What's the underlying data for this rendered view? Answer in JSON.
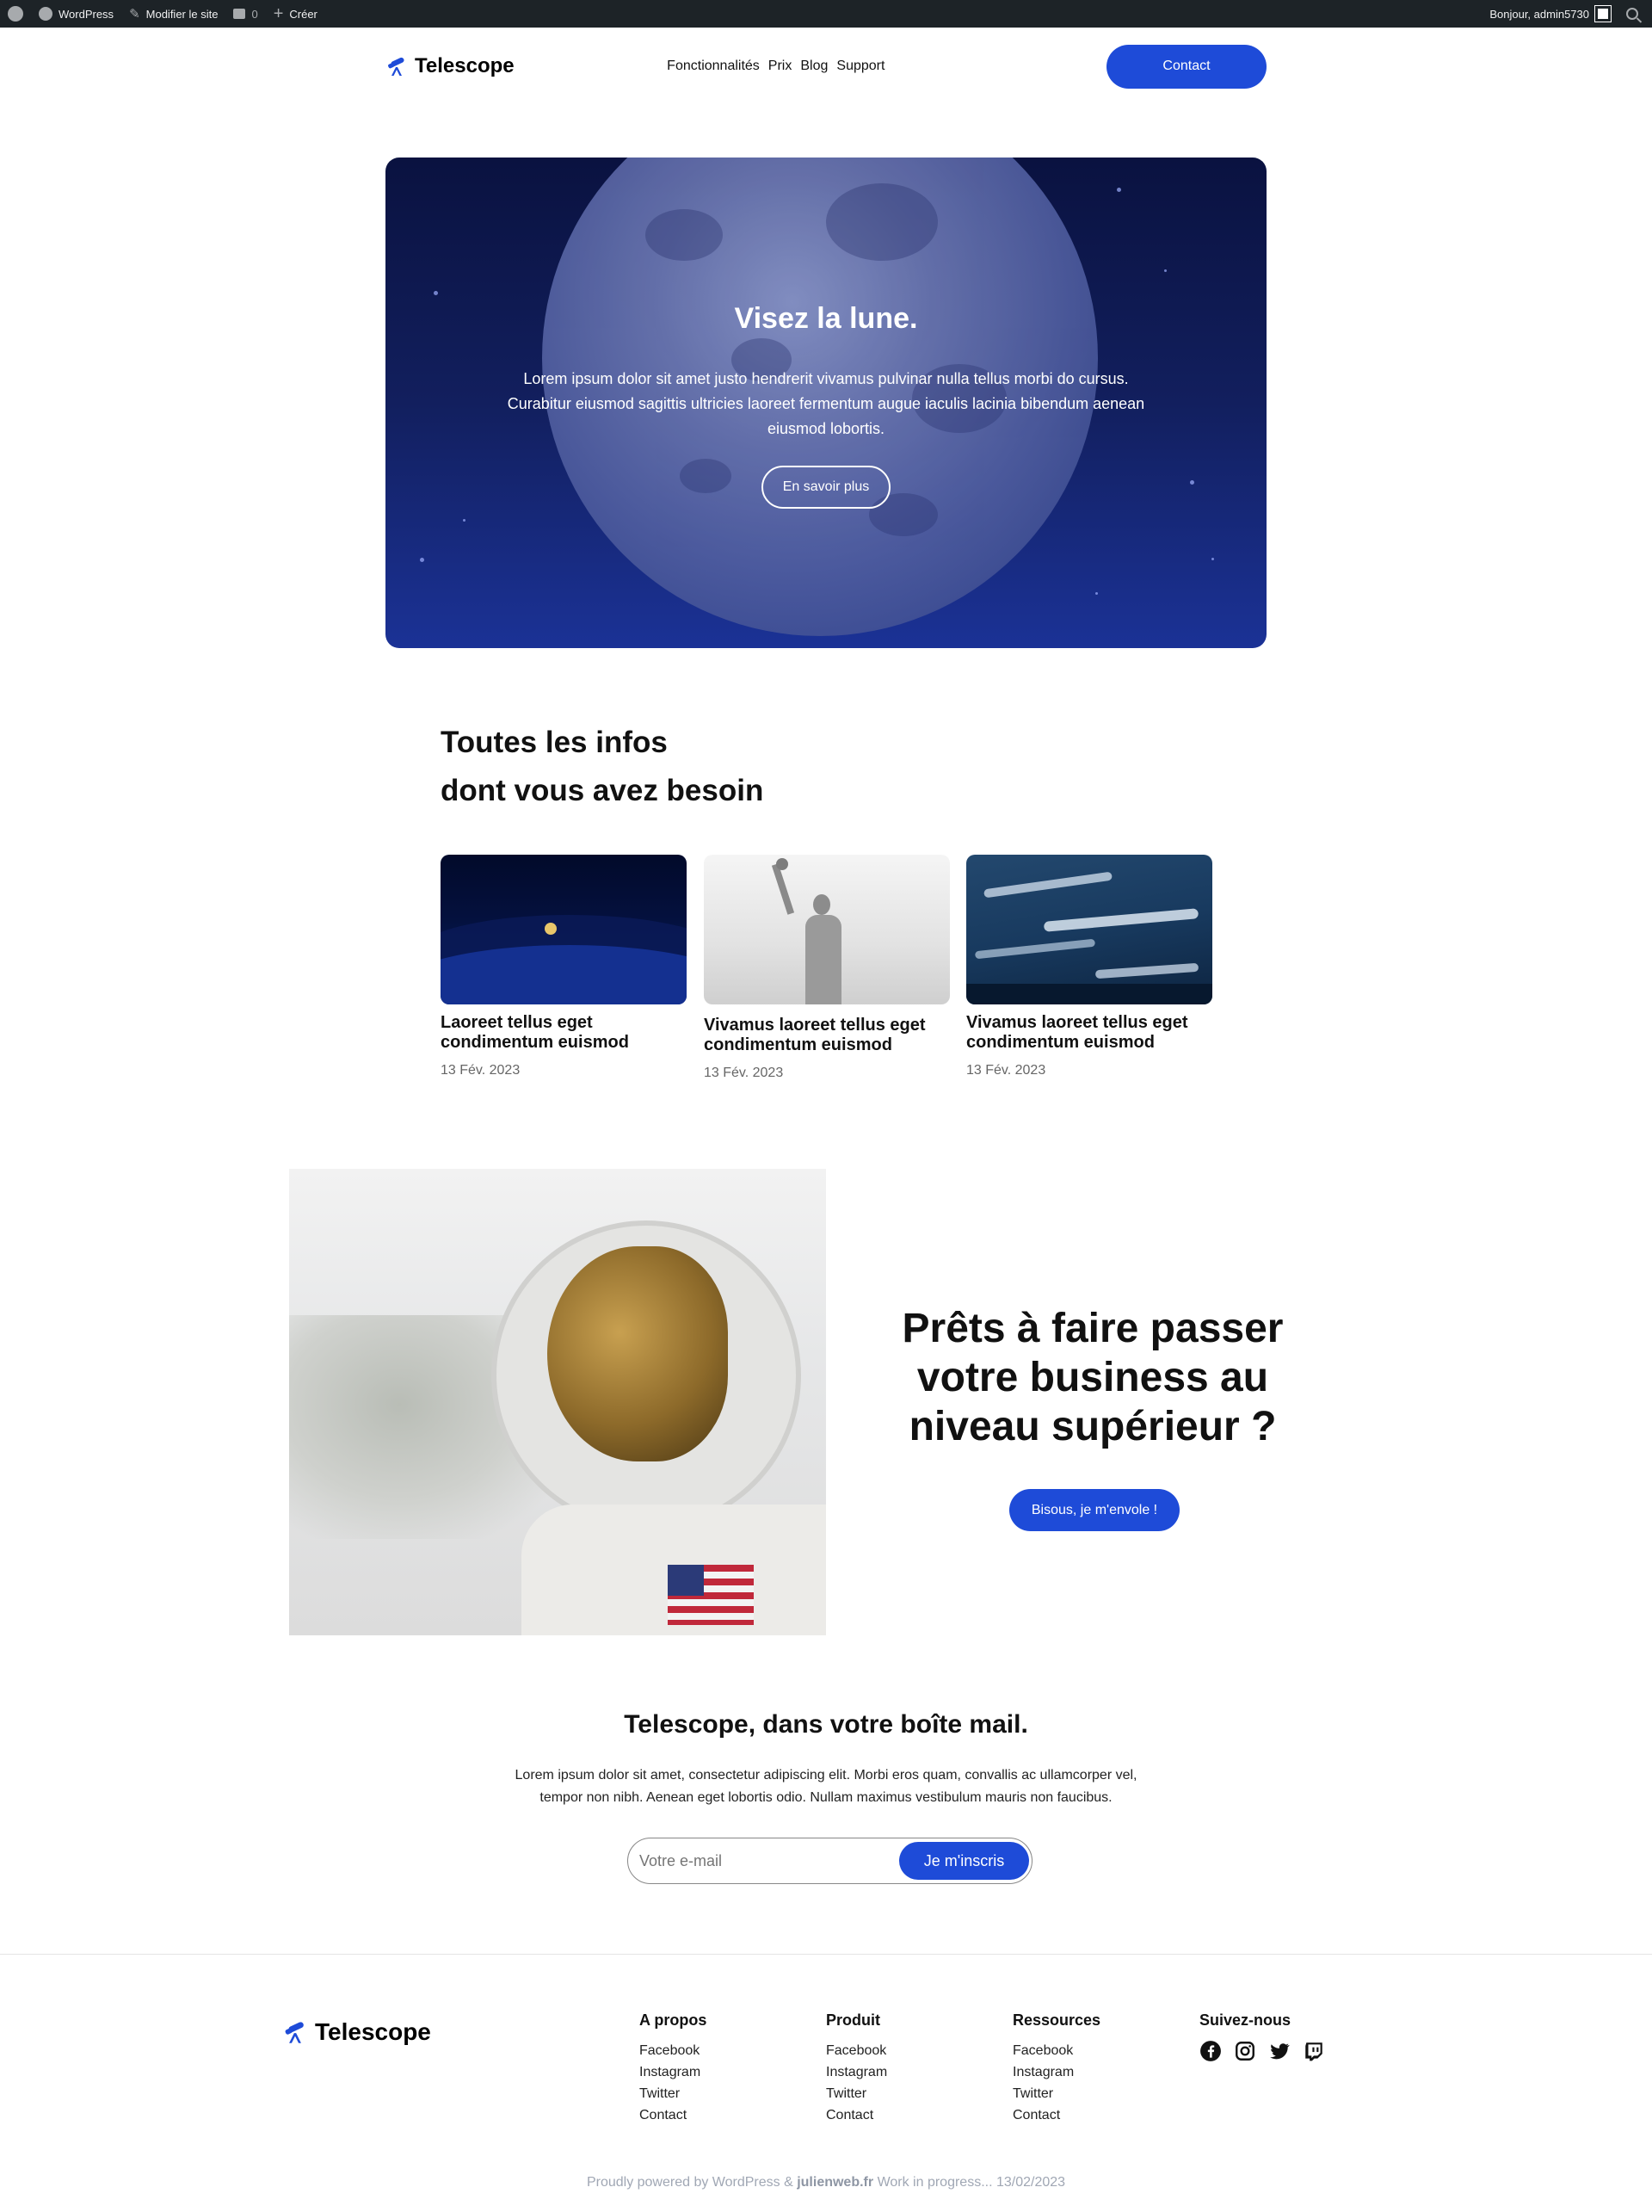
{
  "admin_bar": {
    "wordpress": "WordPress",
    "edit_site": "Modifier le site",
    "comments_count": "0",
    "create": "Créer",
    "greeting": "Bonjour, admin5730"
  },
  "header": {
    "logo": "Telescope",
    "nav": [
      "Fonctionnalités",
      "Prix",
      "Blog",
      "Support"
    ],
    "contact": "Contact"
  },
  "hero": {
    "title": "Visez la lune.",
    "text": "Lorem ipsum dolor sit amet justo hendrerit vivamus pulvinar nulla tellus morbi do cursus. Curabitur eiusmod sagittis ultricies laoreet fermentum augue iaculis lacinia bibendum aenean eiusmod lobortis.",
    "button": "En savoir plus"
  },
  "infos": {
    "title_line1": "Toutes les infos",
    "title_line2": "dont vous avez besoin",
    "cards": [
      {
        "title": "Laoreet tellus eget condimentum euismod",
        "date": "13 Fév. 2023"
      },
      {
        "title": "Vivamus laoreet tellus eget condimentum euismod",
        "date": "13 Fév. 2023"
      },
      {
        "title": "Vivamus laoreet tellus eget condimentum euismod",
        "date": "13 Fév. 2023"
      }
    ]
  },
  "cta": {
    "title": "Prêts à faire passer votre business au niveau supérieur ?",
    "button": "Bisous, je m'envole !"
  },
  "newsletter": {
    "title": "Telescope, dans votre boîte mail.",
    "text": "Lorem ipsum dolor sit amet, consectetur adipiscing elit. Morbi eros quam, convallis ac ullamcorper vel, tempor non nibh. Aenean eget lobortis odio. Nullam maximus vestibulum mauris non faucibus.",
    "placeholder": "Votre e-mail",
    "button": "Je m'inscris"
  },
  "footer": {
    "logo": "Telescope",
    "columns": [
      {
        "heading": "A propos",
        "links": [
          "Facebook",
          "Instagram",
          "Twitter",
          "Contact"
        ]
      },
      {
        "heading": "Produit",
        "links": [
          "Facebook",
          "Instagram",
          "Twitter",
          "Contact"
        ]
      },
      {
        "heading": "Ressources",
        "links": [
          "Facebook",
          "Instagram",
          "Twitter",
          "Contact"
        ]
      }
    ],
    "social_heading": "Suivez-nous",
    "socials": [
      "facebook-icon",
      "instagram-icon",
      "twitter-icon",
      "twitch-icon"
    ],
    "credits_pre": "Proudly powered by WordPress &",
    "credits_site": "julienweb.fr",
    "credits_post": "Work in progress... 13/02/2023"
  },
  "colors": {
    "accent": "#1e4bd8",
    "admin_bar": "#1d2327",
    "hero_top": "#0a1240",
    "hero_bottom": "#1b3296"
  }
}
